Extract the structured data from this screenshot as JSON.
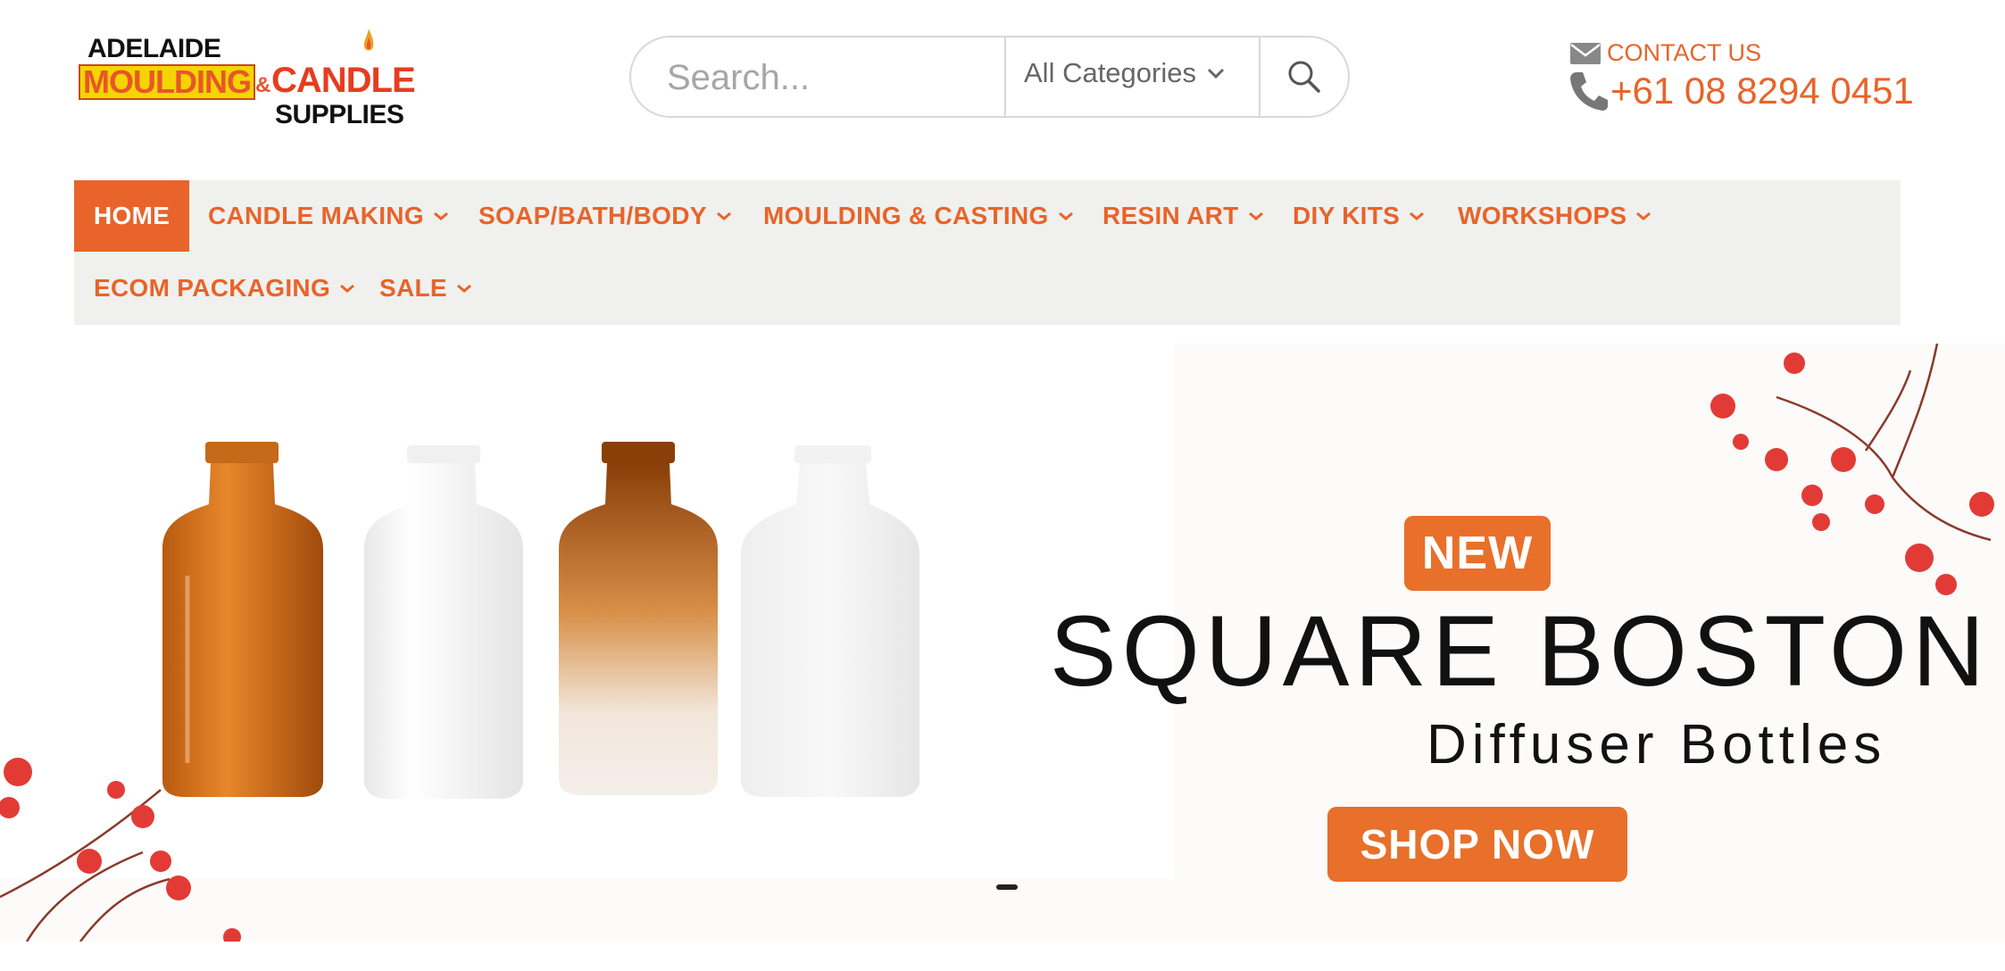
{
  "brand": {
    "logo_line1": "ADELAIDE",
    "logo_line2a": "MOULDING",
    "logo_amp": "&",
    "logo_line2b": "CANDLE",
    "logo_line3": "SUPPLIES"
  },
  "search": {
    "placeholder": "Search...",
    "category": "All Categories"
  },
  "contact": {
    "label": "CONTACT US",
    "phone": "+61 08 8294 0451"
  },
  "nav": {
    "items": [
      {
        "label": "HOME"
      },
      {
        "label": "CANDLE MAKING"
      },
      {
        "label": "SOAP/BATH/BODY"
      },
      {
        "label": "MOULDING & CASTING"
      },
      {
        "label": "RESIN ART"
      },
      {
        "label": "DIY KITS"
      },
      {
        "label": "WORKSHOPS"
      },
      {
        "label": "ECOM PACKAGING"
      },
      {
        "label": "SALE"
      }
    ]
  },
  "hero": {
    "badge": "NEW",
    "title": "SQUARE BOSTON",
    "subtitle": "Diffuser Bottles",
    "cta": "SHOP NOW"
  },
  "colors": {
    "accent": "#e8642a",
    "nav_bg": "#f0f0ee"
  }
}
